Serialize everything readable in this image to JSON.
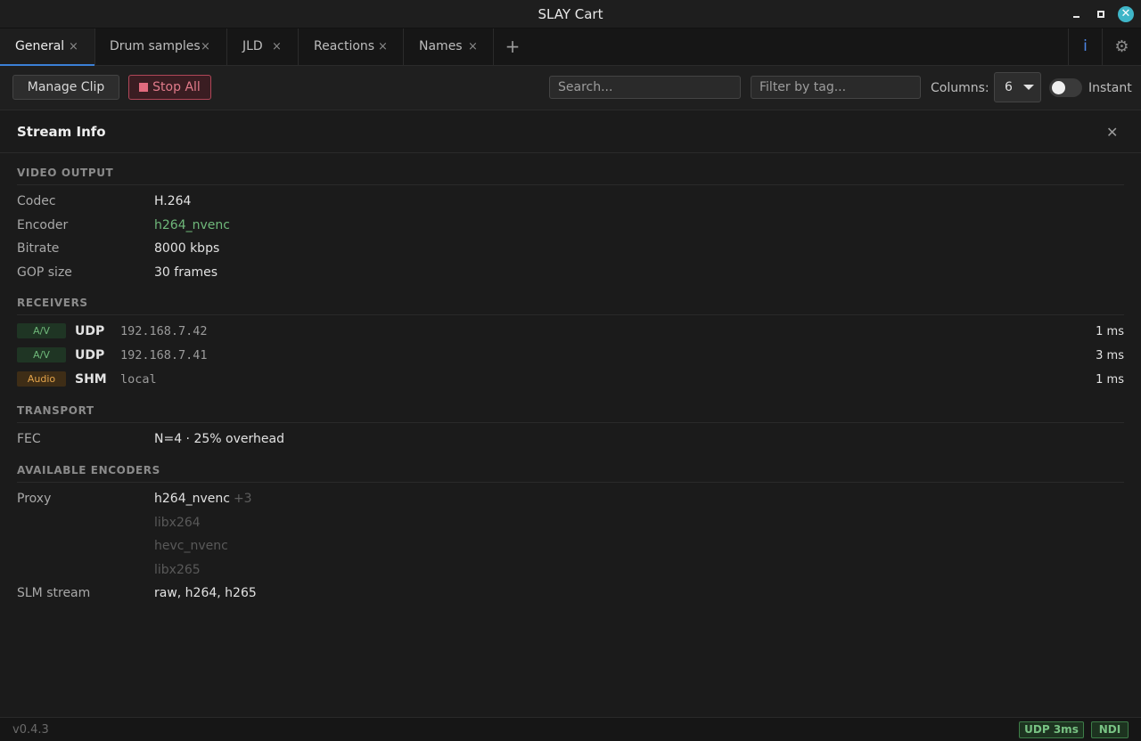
{
  "window": {
    "title": "SLAY Cart",
    "close_glyph": "✕"
  },
  "tabs": [
    {
      "label": "General",
      "active": true
    },
    {
      "label": "Drum samples"
    },
    {
      "label": "JLD"
    },
    {
      "label": "Reactions"
    },
    {
      "label": "Names"
    }
  ],
  "tab_close_glyph": "×",
  "tab_add_glyph": "+",
  "tab_icons": {
    "info": "i",
    "settings": "⚙"
  },
  "toolbar": {
    "manage_label": "Manage Clip",
    "stop_label": "Stop All",
    "search_placeholder": "Search...",
    "tag_placeholder": "Filter by tag...",
    "columns_label": "Columns:",
    "columns_value": "6",
    "instant_label": "Instant",
    "instant_on": false
  },
  "panel": {
    "title": "Stream Info",
    "close_glyph": "✕",
    "video": {
      "title": "VIDEO OUTPUT",
      "rows": [
        {
          "key": "Codec",
          "value": "H.264"
        },
        {
          "key": "Encoder",
          "value": "h264_nvenc"
        },
        {
          "key": "Bitrate",
          "value": "8000 kbps"
        },
        {
          "key": "GOP size",
          "value": "30 frames"
        }
      ]
    },
    "receivers": {
      "title": "RECEIVERS",
      "items": [
        {
          "badge": "A/V",
          "proto": "UDP",
          "addr": "192.168.7.42",
          "latency": "1 ms"
        },
        {
          "badge": "A/V",
          "proto": "UDP",
          "addr": "192.168.7.41",
          "latency": "3 ms"
        },
        {
          "badge": "Audio",
          "proto": "SHM",
          "addr": "local",
          "latency": "1 ms"
        }
      ]
    },
    "transport": {
      "title": "TRANSPORT",
      "rows": [
        {
          "key": "FEC",
          "value": "N=4 · 25% overhead"
        }
      ]
    },
    "encoders": {
      "title": "AVAILABLE ENCODERS",
      "proxy_key": "Proxy",
      "proxy_value": "h264_nvenc",
      "proxy_more": "+3",
      "proxy_alternates": [
        "libx264",
        "hevc_nvenc",
        "libx265"
      ],
      "slm_key": "SLM stream",
      "slm_value": "raw, h264, h265"
    }
  },
  "status": {
    "version": "v0.4.3",
    "udp_pill": "UDP 3ms",
    "ndi_pill": "NDI"
  },
  "colors": {
    "accent": "#3b7fd6",
    "danger": "#e27b8b",
    "ok": "#6fb87a",
    "audio": "#e3a44b"
  }
}
